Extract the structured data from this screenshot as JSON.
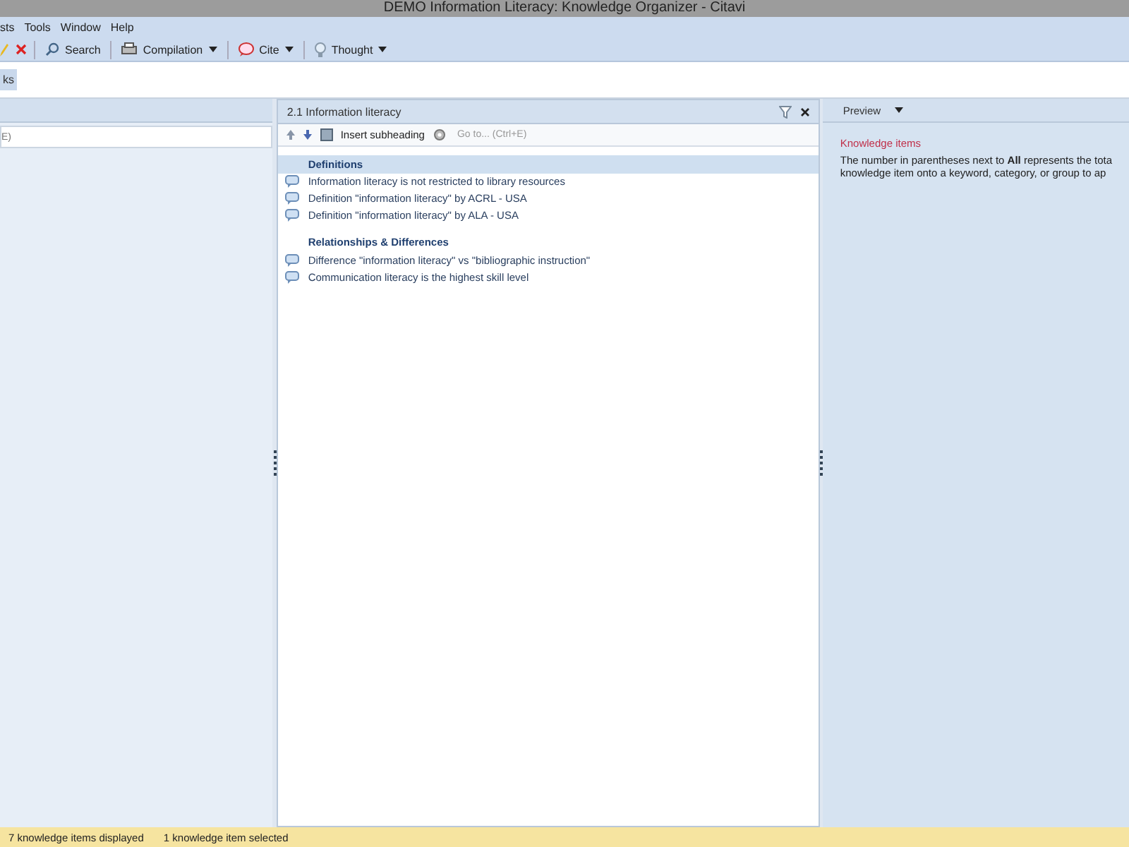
{
  "window": {
    "title": "DEMO Information Literacy: Knowledge Organizer - Citavi"
  },
  "menu": [
    "sts",
    "Tools",
    "Window",
    "Help"
  ],
  "toolbar": [
    {
      "kind": "icon"
    },
    {
      "kind": "icon"
    },
    {
      "kind": "button",
      "label": "Search"
    },
    {
      "kind": "dropdown",
      "label": "Compilation"
    },
    {
      "kind": "dropdown",
      "label": "Cite"
    },
    {
      "kind": "dropdown",
      "label": "Thought"
    }
  ],
  "ribbon_tabs": [
    {
      "label": "ks",
      "selected": true
    }
  ],
  "left_panel": {
    "search": {
      "placeholder": "E)"
    }
  },
  "center_panel": {
    "title": "2.1 Information literacy",
    "insert_button": "Insert subheading",
    "goto": {
      "placeholder": "Go to... (Ctrl+E)"
    },
    "sections": [
      {
        "heading": "Definitions",
        "selected": true,
        "items": [
          "Information literacy is not restricted to library resources",
          "Definition \"information literacy\" by ACRL - USA",
          "Definition \"information literacy\" by ALA - USA"
        ]
      },
      {
        "heading": "Relationships & Differences",
        "selected": false,
        "items": [
          "Difference \"information literacy\" vs \"bibliographic instruction\"",
          "Communication literacy is the highest skill level"
        ]
      }
    ]
  },
  "preview": {
    "title": "Preview",
    "heading": "Knowledge items",
    "lines": [
      "The number in parentheses next to **All** represents the tota",
      "knowledge item onto a keyword, category, or group to ap"
    ]
  },
  "status_bar": [
    "7 knowledge items displayed",
    "1 knowledge item selected"
  ]
}
